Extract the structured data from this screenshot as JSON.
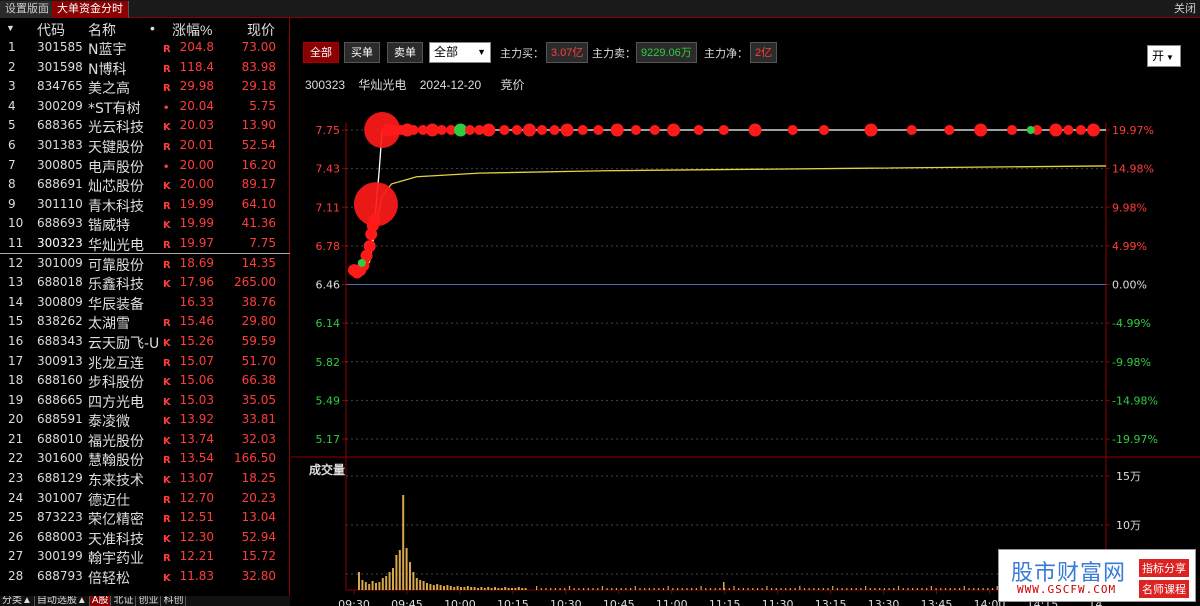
{
  "topbar": {
    "tab1": "设置版面",
    "tab2": "大单资金分时",
    "close": "关闭"
  },
  "list": {
    "headers": {
      "code": "代码",
      "name": "名称",
      "dot": "•",
      "pct": "涨幅%",
      "price": "现价"
    },
    "rows": [
      {
        "idx": "1",
        "code": "301585",
        "name": "N蓝宇",
        "flag": "R",
        "pct": "204.8",
        "price": "73.00"
      },
      {
        "idx": "2",
        "code": "301598",
        "name": "N博科",
        "flag": "R",
        "pct": "118.4",
        "price": "83.98"
      },
      {
        "idx": "3",
        "code": "834765",
        "name": "美之高",
        "flag": "R",
        "pct": "29.98",
        "price": "29.18"
      },
      {
        "idx": "4",
        "code": "300209",
        "name": "*ST有树",
        "flag": "•",
        "pct": "20.04",
        "price": "5.75"
      },
      {
        "idx": "5",
        "code": "688365",
        "name": "光云科技",
        "flag": "K",
        "pct": "20.03",
        "price": "13.90"
      },
      {
        "idx": "6",
        "code": "301383",
        "name": "天键股份",
        "flag": "R",
        "pct": "20.01",
        "price": "52.54"
      },
      {
        "idx": "7",
        "code": "300805",
        "name": "电声股份",
        "flag": "•",
        "pct": "20.00",
        "price": "16.20"
      },
      {
        "idx": "8",
        "code": "688691",
        "name": "灿芯股份",
        "flag": "K",
        "pct": "20.00",
        "price": "89.17"
      },
      {
        "idx": "9",
        "code": "301110",
        "name": "青木科技",
        "flag": "R",
        "pct": "19.99",
        "price": "64.10"
      },
      {
        "idx": "10",
        "code": "688693",
        "name": "锴威特",
        "flag": "K",
        "pct": "19.99",
        "price": "41.36"
      },
      {
        "idx": "11",
        "code": "300323",
        "name": "华灿光电",
        "flag": "R",
        "pct": "19.97",
        "price": "7.75"
      },
      {
        "idx": "12",
        "code": "301009",
        "name": "可靠股份",
        "flag": "R",
        "pct": "18.69",
        "price": "14.35"
      },
      {
        "idx": "13",
        "code": "688018",
        "name": "乐鑫科技",
        "flag": "K",
        "pct": "17.96",
        "price": "265.00"
      },
      {
        "idx": "14",
        "code": "300809",
        "name": "华辰装备",
        "flag": "",
        "pct": "16.33",
        "price": "38.76"
      },
      {
        "idx": "15",
        "code": "838262",
        "name": "太湖雪",
        "flag": "R",
        "pct": "15.46",
        "price": "29.80"
      },
      {
        "idx": "16",
        "code": "688343",
        "name": "云天励飞-U",
        "flag": "K",
        "pct": "15.26",
        "price": "59.59"
      },
      {
        "idx": "17",
        "code": "300913",
        "name": "兆龙互连",
        "flag": "R",
        "pct": "15.07",
        "price": "51.70"
      },
      {
        "idx": "18",
        "code": "688160",
        "name": "步科股份",
        "flag": "K",
        "pct": "15.06",
        "price": "66.38"
      },
      {
        "idx": "19",
        "code": "688665",
        "name": "四方光电",
        "flag": "K",
        "pct": "15.03",
        "price": "35.05"
      },
      {
        "idx": "20",
        "code": "688591",
        "name": "泰凌微",
        "flag": "K",
        "pct": "13.92",
        "price": "33.81"
      },
      {
        "idx": "21",
        "code": "688010",
        "name": "福光股份",
        "flag": "K",
        "pct": "13.74",
        "price": "32.03"
      },
      {
        "idx": "22",
        "code": "301600",
        "name": "慧翰股份",
        "flag": "R",
        "pct": "13.54",
        "price": "166.50"
      },
      {
        "idx": "23",
        "code": "688129",
        "name": "东来技术",
        "flag": "K",
        "pct": "13.07",
        "price": "18.25"
      },
      {
        "idx": "24",
        "code": "301007",
        "name": "德迈仕",
        "flag": "R",
        "pct": "12.70",
        "price": "20.23"
      },
      {
        "idx": "25",
        "code": "873223",
        "name": "荣亿精密",
        "flag": "R",
        "pct": "12.51",
        "price": "13.04"
      },
      {
        "idx": "26",
        "code": "688003",
        "name": "天准科技",
        "flag": "K",
        "pct": "12.30",
        "price": "52.94"
      },
      {
        "idx": "27",
        "code": "300199",
        "name": "翰宇药业",
        "flag": "R",
        "pct": "12.21",
        "price": "15.72"
      },
      {
        "idx": "28",
        "code": "688793",
        "name": "倍轻松",
        "flag": "K",
        "pct": "11.83",
        "price": "32.80"
      }
    ],
    "bottom_tabs": [
      "分类▲",
      "自动选股▲",
      "A股",
      "北证",
      "创业",
      "科创"
    ]
  },
  "toolbar": {
    "btn_all": "全部",
    "btn_buy": "买单",
    "btn_sell": "卖单",
    "select_value": "全部",
    "main_buy_label": "主力买：",
    "main_buy_value": "3.07亿",
    "main_sell_label": "主力卖：",
    "main_sell_value": "9229.06万",
    "main_net_label": "主力净：",
    "main_net_value": "2亿",
    "open_btn": "开"
  },
  "info": {
    "code": "300323",
    "name": "华灿光电",
    "date": "2024-12-20",
    "mode": "竞价"
  },
  "volume_title": "成交量",
  "watermark": {
    "main": "股市财富网",
    "url": "WWW.GSCFW.COM",
    "tag1": "指标分享",
    "tag2": "名师课程"
  },
  "colors": {
    "up": "#ff3d3d",
    "down": "#2ecc40",
    "avg_line": "#e8d23c",
    "price_line": "#ffffff",
    "base_line": "#5566aa",
    "accent": "#8b0000"
  },
  "chart_data": {
    "type": "line",
    "price_axis": [
      "7.75",
      "7.43",
      "7.11",
      "6.78",
      "6.46",
      "6.14",
      "5.82",
      "5.49",
      "5.17"
    ],
    "pct_axis": [
      "19.97%",
      "14.98%",
      "9.98%",
      "4.99%",
      "0.00%",
      "-4.99%",
      "-9.98%",
      "-14.98%",
      "-19.97%"
    ],
    "ylim": [
      5.17,
      7.75
    ],
    "prev_close": 6.46,
    "x_ticks": [
      "09:30",
      "09:45",
      "10:00",
      "10:15",
      "10:30",
      "10:45",
      "11:00",
      "11:15",
      "11:30",
      "13:15",
      "13:30",
      "13:45",
      "14:00",
      "14:15",
      "14"
    ],
    "price_series": [
      [
        0,
        6.56
      ],
      [
        2,
        6.6
      ],
      [
        4,
        6.66
      ],
      [
        5,
        6.72
      ],
      [
        6,
        6.85
      ],
      [
        7,
        7.1
      ],
      [
        8,
        7.4
      ],
      [
        9,
        7.75
      ],
      [
        240,
        7.75
      ]
    ],
    "avg_series": [
      [
        0,
        6.55
      ],
      [
        3,
        6.58
      ],
      [
        5,
        6.65
      ],
      [
        7,
        6.95
      ],
      [
        9,
        7.2
      ],
      [
        12,
        7.3
      ],
      [
        20,
        7.36
      ],
      [
        40,
        7.39
      ],
      [
        80,
        7.41
      ],
      [
        160,
        7.43
      ],
      [
        240,
        7.45
      ]
    ],
    "volume_axis": [
      "15万",
      "10万",
      "5万"
    ],
    "volume_max": 150000
  }
}
